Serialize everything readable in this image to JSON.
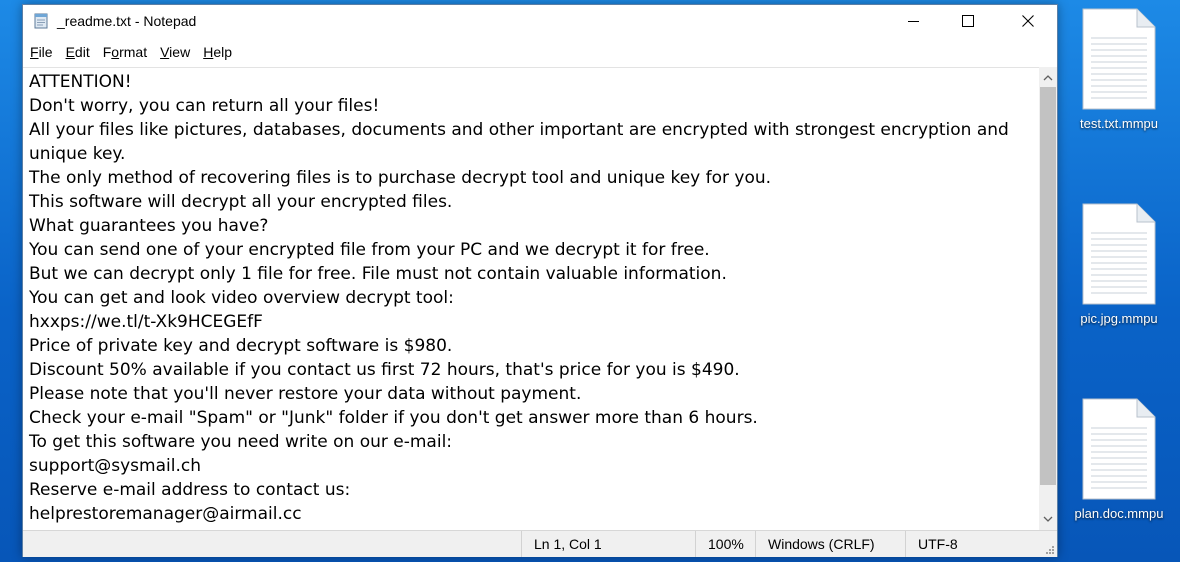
{
  "window": {
    "title": "_readme.txt - Notepad",
    "icon": "notepad-icon"
  },
  "menu": [
    {
      "accel": "F",
      "rest": "ile"
    },
    {
      "accel": "E",
      "rest": "dit"
    },
    {
      "pre": "F",
      "accel": "o",
      "rest": "rmat"
    },
    {
      "accel": "V",
      "rest": "iew"
    },
    {
      "accel": "H",
      "rest": "elp"
    }
  ],
  "document": {
    "lines": [
      "ATTENTION!",
      "Don't worry, you can return all your files!",
      "All your files like pictures, databases, documents and other important are encrypted with strongest encryption and unique key.",
      "The only method of recovering files is to purchase decrypt tool and unique key for you.",
      "This software will decrypt all your encrypted files.",
      "What guarantees you have?",
      "You can send one of your encrypted file from your PC and we decrypt it for free.",
      "But we can decrypt only 1 file for free. File must not contain valuable information.",
      "You can get and look video overview decrypt tool:",
      "hxxps://we.tl/t-Xk9HCEGEfF",
      "Price of private key and decrypt software is $980.",
      "Discount 50% available if you contact us first 72 hours, that's price for you is $490.",
      "Please note that you'll never restore your data without payment.",
      "Check your e-mail \"Spam\" or \"Junk\" folder if you don't get answer more than 6 hours.",
      "To get this software you need write on our e-mail:",
      "support@sysmail.ch",
      "Reserve e-mail address to contact us:",
      "helprestoremanager@airmail.cc"
    ]
  },
  "status": {
    "position": "Ln 1, Col 1",
    "zoom": "100%",
    "line_ending": "Windows (CRLF)",
    "encoding": "UTF-8"
  },
  "desktop": {
    "files": [
      {
        "name": "test.txt.mmpu",
        "icon": "document-icon"
      },
      {
        "name": "pic.jpg.mmpu",
        "icon": "document-icon"
      },
      {
        "name": "plan.doc.mmpu",
        "icon": "document-icon"
      }
    ]
  },
  "colors": {
    "desktop_background": "#0a63c8",
    "window_background": "#ffffff",
    "statusbar_background": "#f0f0f0",
    "scrollbar_thumb": "#c2c2c2"
  }
}
